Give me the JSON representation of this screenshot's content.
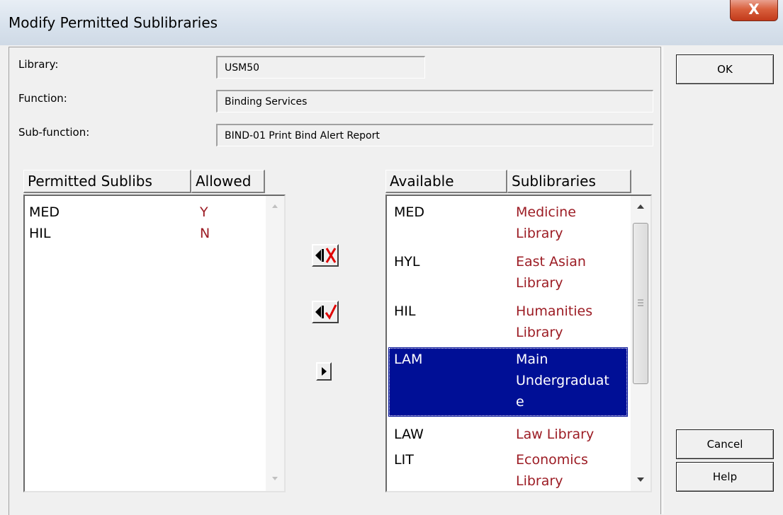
{
  "window": {
    "title": "Modify Permitted Sublibraries",
    "close_glyph": "X"
  },
  "fields": {
    "library_label": "Library:",
    "library_value": "USM50",
    "function_label": "Function:",
    "function_value": "Binding Services",
    "subfunction_label": "Sub-function:",
    "subfunction_value": "BIND-01 Print Bind Alert Report"
  },
  "permitted": {
    "headers": [
      "Permitted Sublibs",
      "Allowed"
    ],
    "rows": [
      {
        "code": "MED",
        "allowed": "Y"
      },
      {
        "code": "HIL",
        "allowed": "N"
      }
    ]
  },
  "available": {
    "headers": [
      "Available",
      "Sublibraries"
    ],
    "rows": [
      {
        "code": "MED",
        "name_lines": [
          "Medicine",
          "Library"
        ],
        "selected": false
      },
      {
        "code": "HYL",
        "name_lines": [
          "East Asian",
          "Library"
        ],
        "selected": false
      },
      {
        "code": "HIL",
        "name_lines": [
          "Humanities",
          "Library"
        ],
        "selected": false
      },
      {
        "code": "LAM",
        "name_lines": [
          "Main",
          "Undergraduat",
          "e"
        ],
        "selected": true
      },
      {
        "code": "LAW",
        "name_lines": [
          "Law Library"
        ],
        "selected": false
      },
      {
        "code": "LIT",
        "name_lines": [
          "Economics",
          "Library"
        ],
        "selected": false
      }
    ]
  },
  "buttons": {
    "ok": "OK",
    "cancel": "Cancel",
    "help": "Help"
  },
  "icons": {
    "remove": "arrow-left-x-icon",
    "allow": "arrow-left-check-icon",
    "add": "arrow-right-icon"
  },
  "colors": {
    "accent_red": "#9c1c24",
    "selection": "#000f96",
    "titlebar": "#d7e1ec",
    "close_button": "#c23a1b"
  }
}
